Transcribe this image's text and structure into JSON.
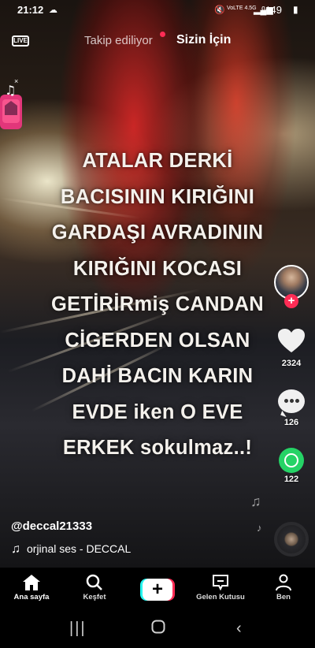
{
  "status_bar": {
    "time": "21:12",
    "network": "VoLTE 4.5G",
    "battery": "%49"
  },
  "top_nav": {
    "live_label": "LIVE",
    "following_tab": "Takip ediliyor",
    "for_you_tab": "Sizin İçin"
  },
  "video": {
    "overlay_lines": [
      "ATALAR DERKİ",
      "BACISININ KIRIĞINI",
      "GARDAŞI AVRADININ",
      "KIRIĞINI KOCASI",
      "GETİRİRmiş CANDAN",
      "CİGERDEN OLSAN",
      "DAHİ BACIN KARIN",
      "EVDE iken O EVE",
      "ERKEK sokulmaz..!"
    ]
  },
  "actions": {
    "likes": "2324",
    "comments": "126",
    "shares": "122",
    "follow_symbol": "+"
  },
  "post": {
    "username": "@deccal21333",
    "sound": "orjinal ses - DECCAL"
  },
  "bottom_nav": {
    "home": "Ana sayfa",
    "discover": "Keşfet",
    "create": "+",
    "inbox": "Gelen Kutusu",
    "profile": "Ben"
  },
  "icons": {
    "accent": "#fe2c55",
    "accent_alt": "#25f4ee",
    "whatsapp": "#25d366"
  }
}
